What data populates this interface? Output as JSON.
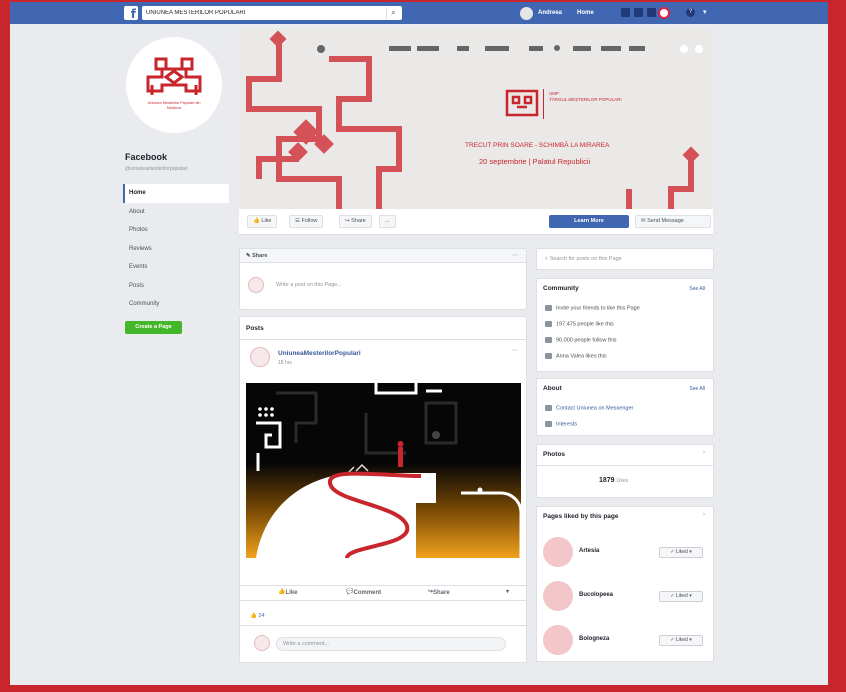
{
  "topbar": {
    "search_value": "UNIUNEA MESTERILOR POPULARI",
    "nav_user": "Andreea",
    "nav_home": "Home"
  },
  "page": {
    "name": "Facebook",
    "handle": "@uniuneamesterilorpopulari",
    "logo_caption": "Uniunea Meșterilor Populari din Moldova"
  },
  "left_nav": [
    "Home",
    "About",
    "Photos",
    "Reviews",
    "Events",
    "Posts",
    "Community"
  ],
  "create_page": "Create a Page",
  "cover": {
    "event_title": "TÂRGUL MEȘTERILOR POPULARI",
    "event_line": "TRECUT PRIN SOARE - SCHIMBĂ LA MIRAREA",
    "event_date": "20 septembrie | Palatul Republicii",
    "event_tag": "UMP"
  },
  "actions": {
    "like": "Like",
    "follow": "Follow",
    "share": "Share",
    "more": "...",
    "learn_more": "Learn More",
    "send_message": "Send Message"
  },
  "composer": {
    "tab": "Share",
    "placeholder": "Write a post on this Page..."
  },
  "posts": {
    "heading": "Posts",
    "author": "UniuneaMesterilorPopulari",
    "time": "18 hrs",
    "like": "Like",
    "comment": "Comment",
    "share": "Share",
    "reaction_count": "24",
    "comment_placeholder": "Write a comment..."
  },
  "right": {
    "search_placeholder": "Search for posts on this Page",
    "community_title": "Community",
    "see_all": "See All",
    "community_rows": [
      "Invite your friends to like this Page",
      "197,475 people like this",
      "90,000 people follow this",
      "Anna Valea likes this"
    ],
    "about_title": "About",
    "about_rows": [
      "Contact Uniunea on Messenger",
      "Interests"
    ],
    "photos_title": "Photos",
    "photos_counter": "1879",
    "photos_counter_suffix": "Likes",
    "liked_title": "Pages liked by this page",
    "liked": [
      {
        "name": "Artesia",
        "btn": "Liked"
      },
      {
        "name": "Bucolopeea",
        "btn": "Liked"
      },
      {
        "name": "Bologneza",
        "btn": "Liked"
      }
    ]
  },
  "colors": {
    "brand_red": "#c8262d",
    "fb_blue": "#4267b2",
    "green": "#42b72a"
  }
}
